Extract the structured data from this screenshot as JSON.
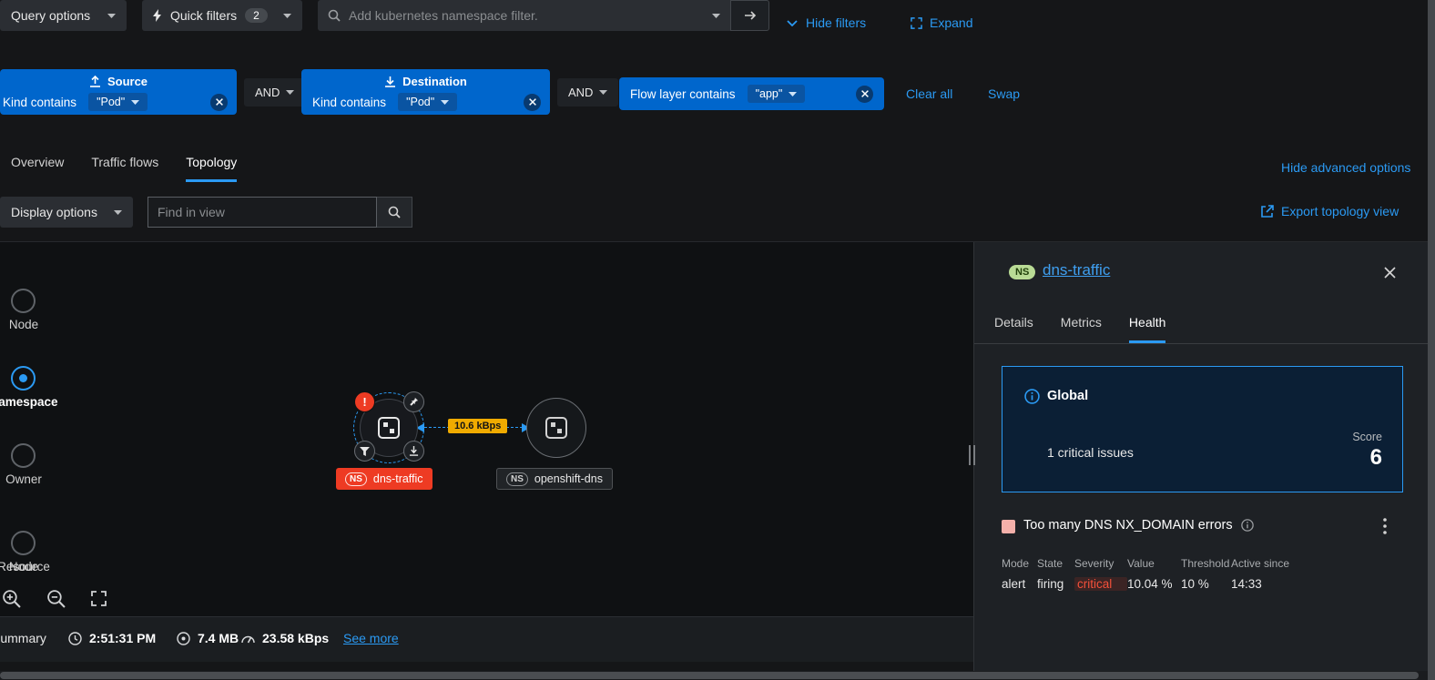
{
  "topbar": {
    "query_options_label": "Query options",
    "quick_filters_label": "Quick filters",
    "quick_filters_count": "2",
    "namespace_filter_placeholder": "Add kubernetes namespace filter.",
    "hide_filters_label": "Hide filters",
    "expand_label": "Expand"
  },
  "filter_bar": {
    "source": {
      "title": "Source",
      "field": "Kind contains",
      "value": "\"Pod\""
    },
    "and_1": "AND",
    "destination": {
      "title": "Destination",
      "field": "Kind contains",
      "value": "\"Pod\""
    },
    "and_2": "AND",
    "flow_layer": {
      "field": "Flow layer contains",
      "value": "\"app\""
    },
    "clear_all_label": "Clear all",
    "swap_label": "Swap"
  },
  "view_tabs": {
    "items": [
      {
        "label": "Overview"
      },
      {
        "label": "Traffic flows"
      },
      {
        "label": "Topology",
        "active": true
      }
    ],
    "hide_advanced_label": "Hide advanced options"
  },
  "display_bar": {
    "display_options_label": "Display options",
    "find_placeholder": "Find in view",
    "export_label": "Export topology view"
  },
  "scope_slider": {
    "items": [
      {
        "label": "Node"
      },
      {
        "label": "Namespace",
        "selected": true
      },
      {
        "label": "Owner"
      },
      {
        "label": "Resource"
      }
    ],
    "selected": "Namespace"
  },
  "topology": {
    "edge_label": "10.6 kBps",
    "source_node": {
      "badge": "NS",
      "name": "dns-traffic",
      "alert_badge": "!",
      "status": "critical"
    },
    "target_node": {
      "badge": "NS",
      "name": "openshift-dns"
    }
  },
  "status_bar": {
    "summary_label": "Summary",
    "time": "2:51:31 PM",
    "bytes": "7.4 MB",
    "rate": "23.58 kBps",
    "see_more_label": "See more"
  },
  "side_panel": {
    "badge": "NS",
    "title": "dns-traffic",
    "tabs": [
      {
        "label": "Details"
      },
      {
        "label": "Metrics"
      },
      {
        "label": "Health",
        "active": true
      }
    ],
    "global_card": {
      "title": "Global",
      "issues_text": "1 critical issues",
      "score_label": "Score",
      "score_value": "6"
    },
    "alert": {
      "title": "Too many DNS NX_DOMAIN errors",
      "columns": [
        "Mode",
        "State",
        "Severity",
        "Value",
        "Threshold",
        "Active since"
      ],
      "mode": "alert",
      "state": "firing",
      "severity": "critical",
      "value": "10.04 %",
      "threshold": "10 %",
      "active_since": "14:33"
    }
  },
  "colors": {
    "accent_blue": "#2b9af3",
    "filter_group_blue": "#0066cc",
    "critical_red": "#ee3b23",
    "edge_label_yellow": "#f0ab00",
    "canvas_bg": "#0f1113",
    "panel_bg": "#1e2125"
  }
}
